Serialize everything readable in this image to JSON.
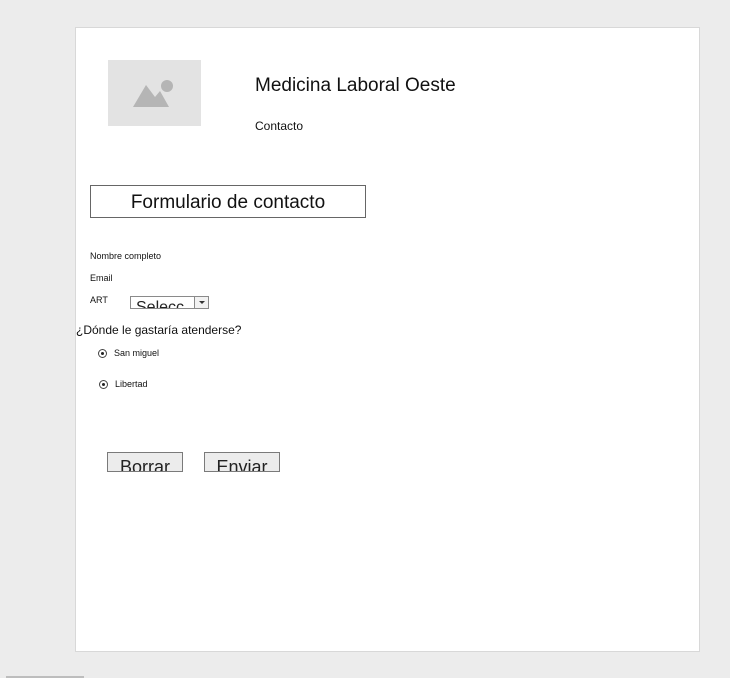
{
  "header": {
    "site_title": "Medicina Laboral Oeste",
    "nav_link": "Contacto",
    "logo_icon": "image-placeholder-icon"
  },
  "form": {
    "heading": "Formulario de contacto",
    "fields": {
      "nombre_label": "Nombre completo",
      "email_label": "Email",
      "art_label": "ART",
      "art_select_value": "Selecc"
    },
    "question": "¿Dónde le gastaría atenderse?",
    "options": [
      {
        "label": "San miguel",
        "selected": true
      },
      {
        "label": "Libertad",
        "selected": true
      }
    ],
    "buttons": {
      "reset_label": "Borrar",
      "submit_label": "Enviar"
    }
  },
  "colors": {
    "background": "#ececec",
    "page": "#ffffff",
    "placeholder": "#e3e3e3",
    "placeholder_glyph": "#b5b5b5"
  }
}
